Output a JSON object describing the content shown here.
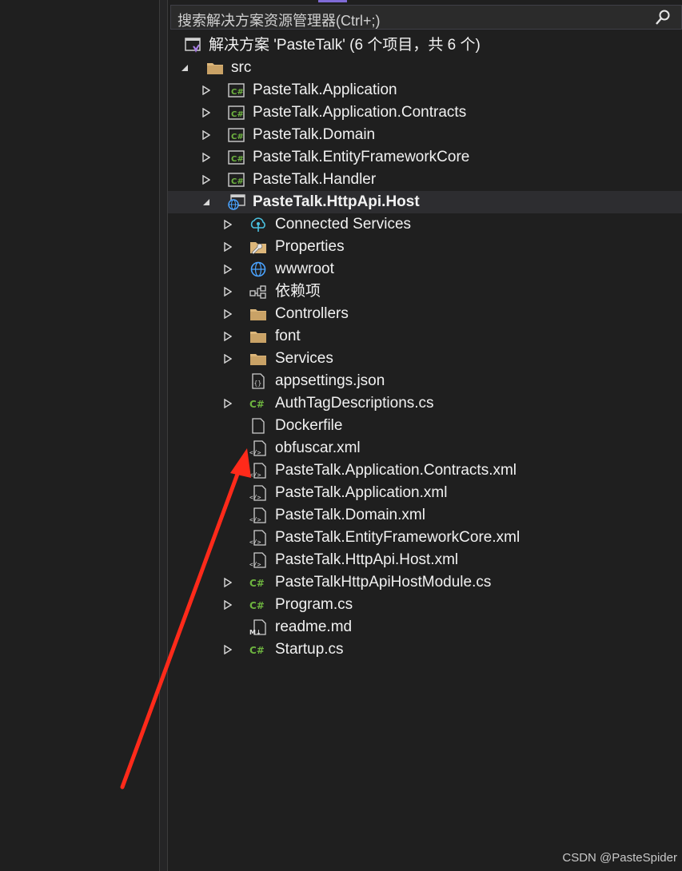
{
  "search": {
    "placeholder": "搜索解决方案资源管理器(Ctrl+;)",
    "icon": "search-icon"
  },
  "solution": {
    "label": "解决方案 'PasteTalk' (6 个项目，共 6 个)",
    "icon": "solution-icon"
  },
  "folder_src": {
    "label": "src",
    "icon": "folder-icon",
    "expanded": true
  },
  "projects": [
    {
      "label": "PasteTalk.Application",
      "icon": "csharp-project-icon",
      "expanded": false
    },
    {
      "label": "PasteTalk.Application.Contracts",
      "icon": "csharp-project-icon",
      "expanded": false
    },
    {
      "label": "PasteTalk.Domain",
      "icon": "csharp-project-icon",
      "expanded": false
    },
    {
      "label": "PasteTalk.EntityFrameworkCore",
      "icon": "csharp-project-icon",
      "expanded": false
    },
    {
      "label": "PasteTalk.Handler",
      "icon": "csharp-project-icon",
      "expanded": false
    }
  ],
  "host_project": {
    "label": "PasteTalk.HttpApi.Host",
    "icon": "web-project-icon",
    "expanded": true,
    "children": [
      {
        "label": "Connected Services",
        "icon": "connected-services-icon",
        "expandable": true
      },
      {
        "label": "Properties",
        "icon": "properties-icon",
        "expandable": true
      },
      {
        "label": "wwwroot",
        "icon": "globe-icon",
        "expandable": true
      },
      {
        "label": "依赖项",
        "icon": "dependencies-icon",
        "expandable": true
      },
      {
        "label": "Controllers",
        "icon": "folder-icon",
        "expandable": true
      },
      {
        "label": "font",
        "icon": "folder-icon",
        "expandable": true
      },
      {
        "label": "Services",
        "icon": "folder-icon",
        "expandable": true
      },
      {
        "label": "appsettings.json",
        "icon": "json-file-icon",
        "expandable": false
      },
      {
        "label": "AuthTagDescriptions.cs",
        "icon": "csharp-file-icon",
        "expandable": true
      },
      {
        "label": "Dockerfile",
        "icon": "file-icon",
        "expandable": false
      },
      {
        "label": "obfuscar.xml",
        "icon": "xml-file-icon",
        "expandable": false
      },
      {
        "label": "PasteTalk.Application.Contracts.xml",
        "icon": "xml-file-icon",
        "expandable": false
      },
      {
        "label": "PasteTalk.Application.xml",
        "icon": "xml-file-icon",
        "expandable": false
      },
      {
        "label": "PasteTalk.Domain.xml",
        "icon": "xml-file-icon",
        "expandable": false
      },
      {
        "label": "PasteTalk.EntityFrameworkCore.xml",
        "icon": "xml-file-icon",
        "expandable": false
      },
      {
        "label": "PasteTalk.HttpApi.Host.xml",
        "icon": "xml-file-icon",
        "expandable": false
      },
      {
        "label": "PasteTalkHttpApiHostModule.cs",
        "icon": "csharp-file-icon",
        "expandable": true
      },
      {
        "label": "Program.cs",
        "icon": "csharp-file-icon",
        "expandable": true
      },
      {
        "label": "readme.md",
        "icon": "markdown-file-icon",
        "expandable": false
      },
      {
        "label": "Startup.cs",
        "icon": "csharp-file-icon",
        "expandable": true
      }
    ]
  },
  "watermark": "CSDN @PasteSpider",
  "colors": {
    "background": "#1f1f1f",
    "text": "#f1f1f1",
    "csharp": "#6db33f",
    "folder": "#dcb67a",
    "annotation_arrow": "#ff2a1a",
    "accent": "#7f6bd6"
  }
}
